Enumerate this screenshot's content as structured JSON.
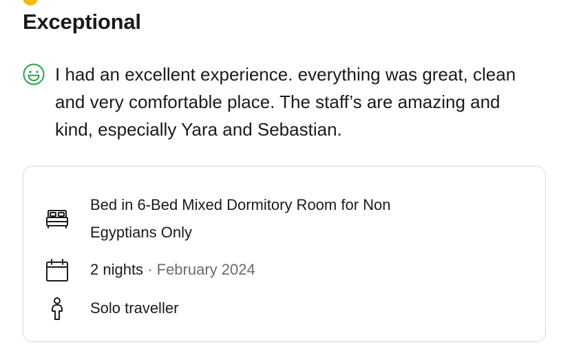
{
  "review": {
    "rating_label": "Exceptional",
    "text": "I had an excellent experience. everything was great, clean and very comfortable place. The staff’s are amazing and kind, especially Yara and Sebastian.",
    "sentiment_icon": "smile-icon",
    "accent_color": "#2e9e4a"
  },
  "details": {
    "room_line1": "Bed in 6-Bed Mixed Dormitory Room for Non",
    "room_line2": "Egyptians Only",
    "nights": "2 nights",
    "separator": " · ",
    "date": "February 2024",
    "traveller_type": "Solo traveller",
    "icons": [
      "bed-icon",
      "calendar-icon",
      "person-icon"
    ]
  }
}
